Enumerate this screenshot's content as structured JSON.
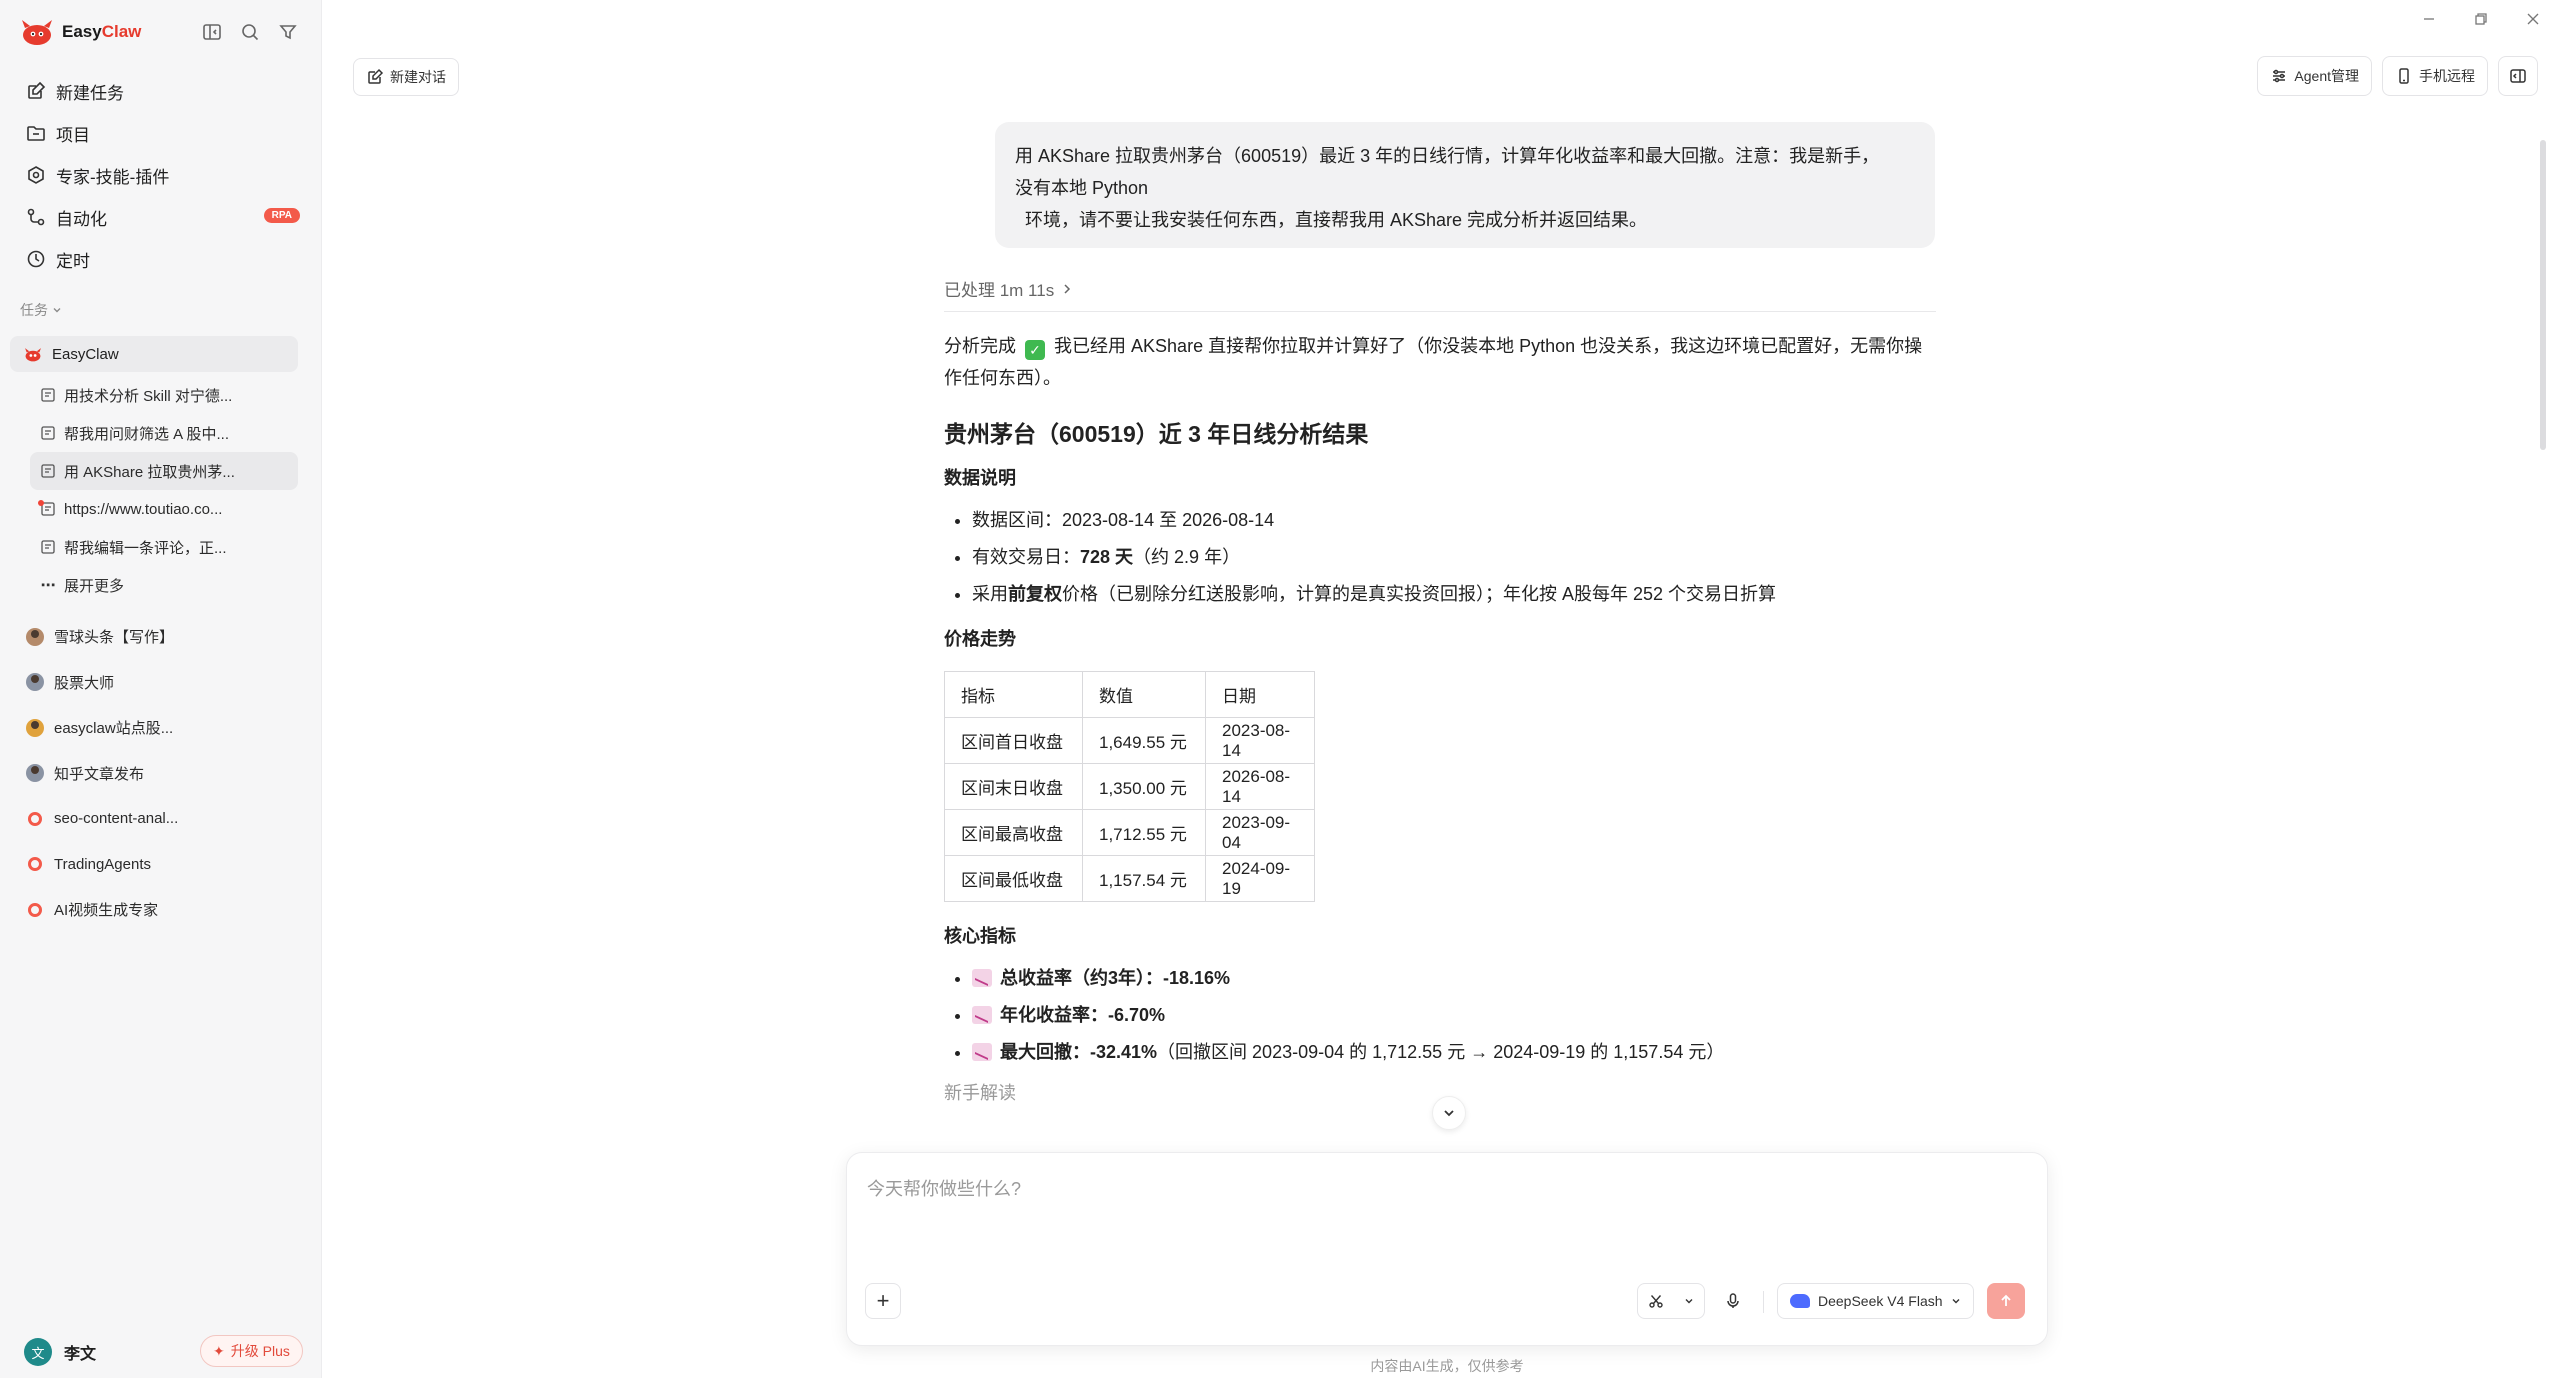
{
  "app": {
    "name_part1": "Easy",
    "name_part2": "Claw",
    "brand_color": "#e63b2e"
  },
  "sidebar": {
    "nav": [
      {
        "label": "新建任务",
        "icon": "new-task-icon"
      },
      {
        "label": "项目",
        "icon": "folder-icon"
      },
      {
        "label": "专家-技能-插件",
        "icon": "puzzle-icon"
      },
      {
        "label": "自动化",
        "icon": "automation-icon",
        "badge": "RPA"
      },
      {
        "label": "定时",
        "icon": "clock-icon"
      }
    ],
    "section_label": "任务",
    "task_group": {
      "title": "EasyClaw",
      "items": [
        {
          "label": "用技术分析 Skill 对宁德..."
        },
        {
          "label": "帮我用问财筛选 A 股中..."
        },
        {
          "label": "用 AKShare 拉取贵州茅...",
          "active": true
        },
        {
          "label": "https://www.toutiao.co...",
          "unread": true
        },
        {
          "label": "帮我编辑一条评论，正..."
        }
      ],
      "more_label": "展开更多"
    },
    "agents": [
      {
        "label": "雪球头条【写作】",
        "icon": "person-avatar-icon"
      },
      {
        "label": "股票大师",
        "icon": "person-avatar-icon"
      },
      {
        "label": "easyclaw站点股...",
        "icon": "person-avatar-icon"
      },
      {
        "label": "知乎文章发布",
        "icon": "person-avatar-icon"
      },
      {
        "label": "seo-content-anal...",
        "icon": "swirl-icon"
      },
      {
        "label": "TradingAgents",
        "icon": "swirl-icon"
      },
      {
        "label": "AI视频生成专家",
        "icon": "swirl-icon"
      }
    ],
    "user": {
      "avatar_text": "文",
      "name": "李文",
      "upgrade_label": "升级 Plus"
    }
  },
  "topbar": {
    "new_chat_label": "新建对话",
    "agent_manage_label": "Agent管理",
    "phone_remote_label": "手机远程"
  },
  "chat": {
    "user_message_lines": [
      "用 AKShare 拉取贵州茅台（600519）最近 3 年的日线行情，计算年化收益率和最大回撤。注意：我是新手，",
      "没有本地 Python",
      "  环境，请不要让我安装任何东西，直接帮我用 AKShare 完成分析并返回结果。"
    ],
    "processed_label": "已处理 1m 11s",
    "intro_before_check": "分析完成",
    "intro_after_check": "我已经用 AKShare 直接帮你拉取并计算好了（你没装本地 Python 也没关系，我这边环境已配置好，无需你操作任何东西）。",
    "heading": "贵州茅台（600519）近 3 年日线分析结果",
    "data_section_title": "数据说明",
    "data_bullets": [
      {
        "prefix": "数据区间：",
        "bold": "",
        "text": "2023-08-14 至 2026-08-14"
      },
      {
        "prefix": "有效交易日：",
        "bold": "728 天",
        "text": "（约 2.9 年）"
      },
      {
        "prefix": "采用",
        "bold": "前复权",
        "text": "价格（已剔除分红送股影响，计算的是真实投资回报）；年化按 A股每年 252 个交易日折算"
      }
    ],
    "price_section_title": "价格走势",
    "table": {
      "headers": [
        "指标",
        "数值",
        "日期"
      ],
      "rows": [
        [
          "区间首日收盘",
          "1,649.55 元",
          "2023-08-14"
        ],
        [
          "区间末日收盘",
          "1,350.00 元",
          "2026-08-14"
        ],
        [
          "区间最高收盘",
          "1,712.55 元",
          "2023-09-04"
        ],
        [
          "区间最低收盘",
          "1,157.54 元",
          "2024-09-19"
        ]
      ]
    },
    "core_section_title": "核心指标",
    "core_bullets": [
      {
        "bold": "总收益率（约3年）：-18.16%",
        "text": ""
      },
      {
        "bold": "年化收益率：-6.70%",
        "text": ""
      },
      {
        "bold": "最大回撤：-32.41%",
        "text": "（回撤区间 2023-09-04 的 1,712.55 元 → 2024-09-19 的 1,157.54 元）"
      }
    ],
    "next_section_title": "新手解读"
  },
  "composer": {
    "placeholder": "今天帮你做些什么?",
    "model_label": "DeepSeek V4 Flash",
    "disclaimer": "内容由AI生成，仅供参考"
  }
}
